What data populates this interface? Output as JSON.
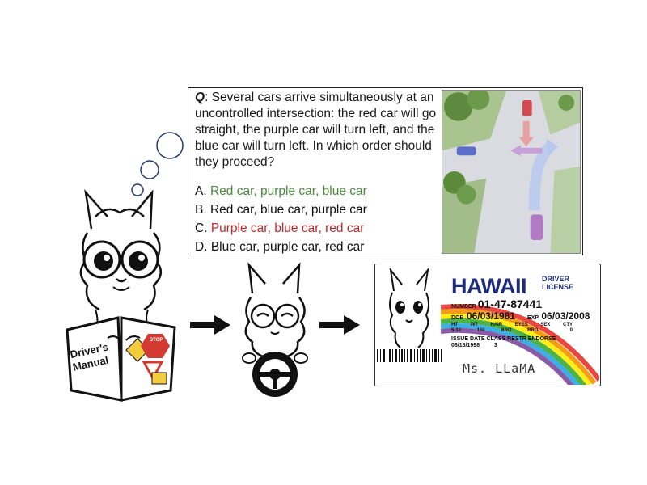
{
  "question": {
    "q_label": "Q",
    "text": ": Several cars arrive simultaneously at an uncontrolled intersection: the red car will go straight, the purple car will turn left, and the blue car will turn left. In which order should they proceed?",
    "options": [
      {
        "letter": "A.",
        "text": "Red car, purple car, blue car",
        "color": "#4a8a3a"
      },
      {
        "letter": "B.",
        "text": "Red car, blue car, purple car",
        "color": "#1a1a1a"
      },
      {
        "letter": "C.",
        "text": "Purple car, blue car, red car",
        "color": "#c0282d"
      },
      {
        "letter": "D.",
        "text": "Blue car, purple car, red car",
        "color": "#1a1a1a"
      }
    ]
  },
  "book": {
    "title_line1": "Driver's",
    "title_line2": "Manual",
    "sign_text": "STOP"
  },
  "license": {
    "state": "HAWAII",
    "type_line1": "DRIVER",
    "type_line2": "LICENSE",
    "number_label": "NUMBER",
    "number": "01-47-87441",
    "dob_label": "DOB",
    "dob": "06/03/1981",
    "exp_label": "EXP",
    "exp": "06/03/2008",
    "fields": [
      "HT",
      "WT",
      "HAIR",
      "EYES",
      "SEX",
      "CTY"
    ],
    "values": [
      "5-10",
      "150",
      "BRO",
      "BRO",
      "",
      "0"
    ],
    "issue_label": "ISSUE DATE",
    "class_label": "CLASS",
    "restr_label": "RESTR",
    "endorse_label": "ENDORSE",
    "issue_date": "06/18/1998",
    "class_value": "3",
    "signature": "Ms. LLaMA"
  },
  "colors": {
    "accent_green": "#4a8a3a",
    "accent_red": "#c0282d",
    "license_blue": "#1c2a78"
  }
}
